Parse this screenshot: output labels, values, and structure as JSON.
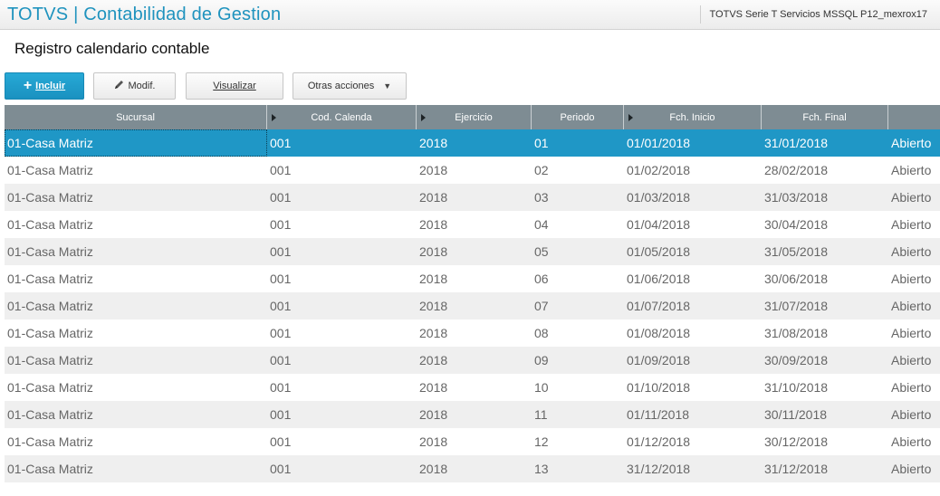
{
  "header": {
    "app_title": "TOTVS | Contabilidad de Gestion",
    "environment": "TOTVS Serie T Servicios MSSQL P12_mexrox17"
  },
  "page": {
    "title": "Registro calendario contable"
  },
  "toolbar": {
    "incluir": "Incluir",
    "modif": "Modif.",
    "visualizar": "Visualizar",
    "otras": "Otras acciones"
  },
  "table": {
    "columns": [
      "Sucursal",
      "Cod. Calenda",
      "Ejercicio",
      "Periodo",
      "Fch. Inicio",
      "Fch. Final",
      ""
    ],
    "rows": [
      [
        "01-Casa Matriz",
        "001",
        "2018",
        "01",
        "01/01/2018",
        "31/01/2018",
        "Abierto"
      ],
      [
        "01-Casa Matriz",
        "001",
        "2018",
        "02",
        "01/02/2018",
        "28/02/2018",
        "Abierto"
      ],
      [
        "01-Casa Matriz",
        "001",
        "2018",
        "03",
        "01/03/2018",
        "31/03/2018",
        "Abierto"
      ],
      [
        "01-Casa Matriz",
        "001",
        "2018",
        "04",
        "01/04/2018",
        "30/04/2018",
        "Abierto"
      ],
      [
        "01-Casa Matriz",
        "001",
        "2018",
        "05",
        "01/05/2018",
        "31/05/2018",
        "Abierto"
      ],
      [
        "01-Casa Matriz",
        "001",
        "2018",
        "06",
        "01/06/2018",
        "30/06/2018",
        "Abierto"
      ],
      [
        "01-Casa Matriz",
        "001",
        "2018",
        "07",
        "01/07/2018",
        "31/07/2018",
        "Abierto"
      ],
      [
        "01-Casa Matriz",
        "001",
        "2018",
        "08",
        "01/08/2018",
        "31/08/2018",
        "Abierto"
      ],
      [
        "01-Casa Matriz",
        "001",
        "2018",
        "09",
        "01/09/2018",
        "30/09/2018",
        "Abierto"
      ],
      [
        "01-Casa Matriz",
        "001",
        "2018",
        "10",
        "01/10/2018",
        "31/10/2018",
        "Abierto"
      ],
      [
        "01-Casa Matriz",
        "001",
        "2018",
        "11",
        "01/11/2018",
        "30/11/2018",
        "Abierto"
      ],
      [
        "01-Casa Matriz",
        "001",
        "2018",
        "12",
        "01/12/2018",
        "30/12/2018",
        "Abierto"
      ],
      [
        "01-Casa Matriz",
        "001",
        "2018",
        "13",
        "31/12/2018",
        "31/12/2018",
        "Abierto"
      ]
    ]
  },
  "colors": {
    "accent": "#1f93be",
    "selected_row": "#1f97c6",
    "header_bg": "#7e8c93",
    "stripe": "#efefef"
  }
}
